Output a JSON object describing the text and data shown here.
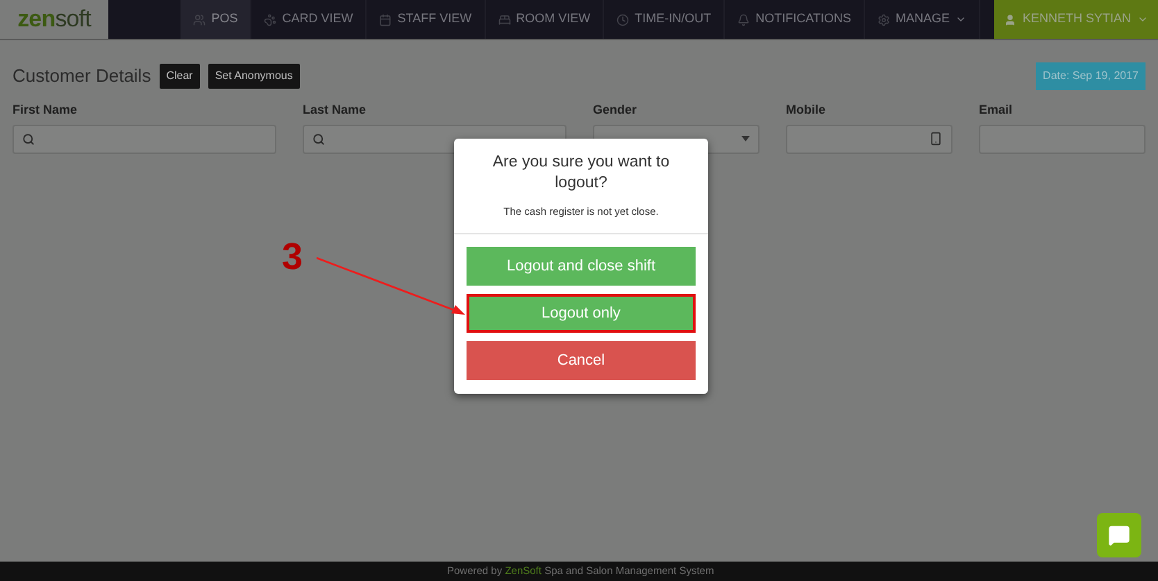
{
  "logo": {
    "text_1": "zen",
    "text_2": "soft"
  },
  "nav": {
    "items": [
      {
        "label": "POS",
        "selected": true,
        "dropdown": false
      },
      {
        "label": "CARD VIEW",
        "selected": false,
        "dropdown": false
      },
      {
        "label": "STAFF VIEW",
        "selected": false,
        "dropdown": false
      },
      {
        "label": "ROOM VIEW",
        "selected": false,
        "dropdown": false
      },
      {
        "label": "TIME-IN/OUT",
        "selected": false,
        "dropdown": false
      },
      {
        "label": "NOTIFICATIONS",
        "selected": false,
        "dropdown": false
      },
      {
        "label": "MANAGE",
        "selected": false,
        "dropdown": true
      }
    ],
    "user": {
      "label": "KENNETH SYTIAN",
      "dropdown": true
    }
  },
  "customer": {
    "title": "Customer Details",
    "buttons": [
      "Clear",
      "Set Anonymous"
    ],
    "date": "Date: Sep 19, 2017",
    "fields": [
      {
        "label": "First Name",
        "kind": "search"
      },
      {
        "label": "Last Name",
        "kind": "search"
      },
      {
        "label": "Gender",
        "kind": "select"
      },
      {
        "label": "Mobile",
        "kind": "phone"
      },
      {
        "label": "Email",
        "kind": "text"
      }
    ]
  },
  "modal": {
    "title": "Are you sure you want to logout?",
    "message": "The cash register is not yet close.",
    "buttons": [
      {
        "label": "Logout and close shift",
        "kind": "success",
        "highlighted": false
      },
      {
        "label": "Logout only",
        "kind": "success",
        "highlighted": true
      },
      {
        "label": "Cancel",
        "kind": "danger",
        "highlighted": false
      }
    ]
  },
  "annotation": {
    "label": "3"
  },
  "footer": {
    "prefix": "Powered by",
    "brand": "ZenSoft",
    "suffix": "Spa and Salon Management System"
  }
}
